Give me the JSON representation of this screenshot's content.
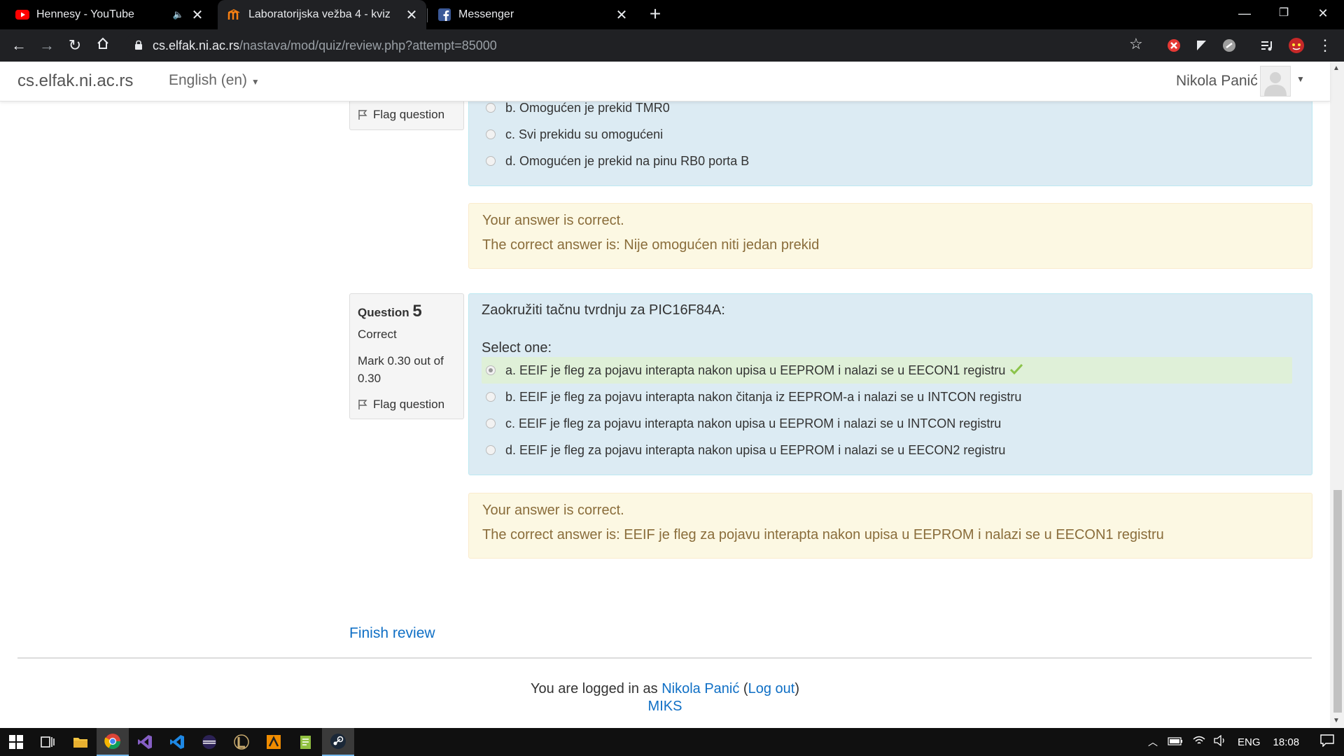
{
  "browser": {
    "tabs": [
      {
        "title": "Hennesy - YouTube",
        "icon": "youtube-icon",
        "active": false
      },
      {
        "title": "Laboratorijska vežba 4 - kviz",
        "icon": "moodle-icon",
        "active": true
      },
      {
        "title": "Messenger",
        "icon": "facebook-icon",
        "active": false
      }
    ],
    "url_host": "cs.elfak.ni.ac.rs",
    "url_path": "/nastava/mod/quiz/review.php?attempt=85000"
  },
  "navbar": {
    "brand": "cs.elfak.ni.ac.rs",
    "language": "English (en)",
    "user": "Nikola Panić"
  },
  "question4": {
    "flag_label": "Flag question",
    "options": [
      {
        "label": "b. Omogućen je prekid TMR0"
      },
      {
        "label": "c. Svi prekidu su omogućeni"
      },
      {
        "label": "d. Omogućen je prekid na pinu RB0 porta B"
      }
    ],
    "feedback_status": "Your answer is correct.",
    "feedback_answer": "The correct answer is: Nije omogućen niti jedan prekid"
  },
  "question5": {
    "label": "Question",
    "number": "5",
    "state": "Correct",
    "mark": "Mark 0.30 out of 0.30",
    "flag_label": "Flag question",
    "prompt": "Zaokružiti tačnu tvrdnju za PIC16F84A:",
    "select_label": "Select one:",
    "options": [
      {
        "label": "a. EEIF je fleg za pojavu interapta nakon upisa u EEPROM i nalazi se u EECON1 registru",
        "selected": true,
        "correct": true
      },
      {
        "label": "b. EEIF je fleg za pojavu interapta nakon čitanja iz EEPROM-a i nalazi se u INTCON registru",
        "selected": false
      },
      {
        "label": "c. EEIF je fleg za pojavu interapta nakon upisa u EEPROM i nalazi se u INTCON registru",
        "selected": false
      },
      {
        "label": "d. EEIF je fleg za pojavu interapta nakon upisa u EEPROM i nalazi se u EECON2 registru",
        "selected": false
      }
    ],
    "feedback_status": "Your answer is correct.",
    "feedback_answer": "The correct answer is: EEIF je fleg za pojavu interapta nakon upisa u EEPROM i nalazi se u EECON1 registru"
  },
  "finish_review": "Finish review",
  "footer": {
    "logged_in_prefix": "You are logged in as",
    "user": "Nikola Panić",
    "logout": "Log out",
    "course_link": "MIKS"
  },
  "taskbar": {
    "language": "ENG",
    "time": "18:08"
  },
  "colors": {
    "link": "#0f6fc5",
    "formulation_bg": "#dcebf3",
    "feedback_bg": "#fcf8e3",
    "feedback_text": "#8a6d3b",
    "correct_bg": "#dff0d8",
    "check": "#8bc34a"
  }
}
